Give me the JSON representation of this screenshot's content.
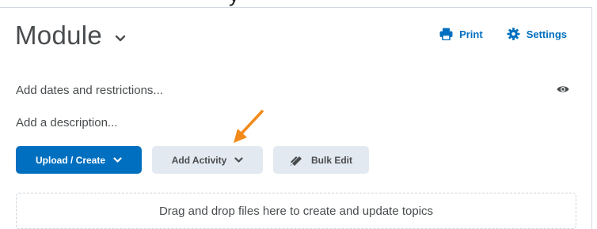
{
  "module": {
    "title": "Module",
    "dates_link": "Add dates and restrictions...",
    "description_link": "Add a description..."
  },
  "header_actions": {
    "print_label": "Print",
    "settings_label": "Settings"
  },
  "toolbar": {
    "upload_create_label": "Upload / Create",
    "add_activity_label": "Add Activity",
    "bulk_edit_label": "Bulk Edit"
  },
  "dropzone": {
    "text": "Drag and drop files here to create and update topics"
  },
  "colors": {
    "primary": "#006fbf",
    "secondary_button": "#e3e9f1",
    "annotation_arrow": "#f28a1a",
    "text": "#494c4e"
  },
  "icons": [
    "chevron-down-icon",
    "printer-icon",
    "gear-icon",
    "eye-icon",
    "pencil-icon",
    "annotation-arrow"
  ]
}
